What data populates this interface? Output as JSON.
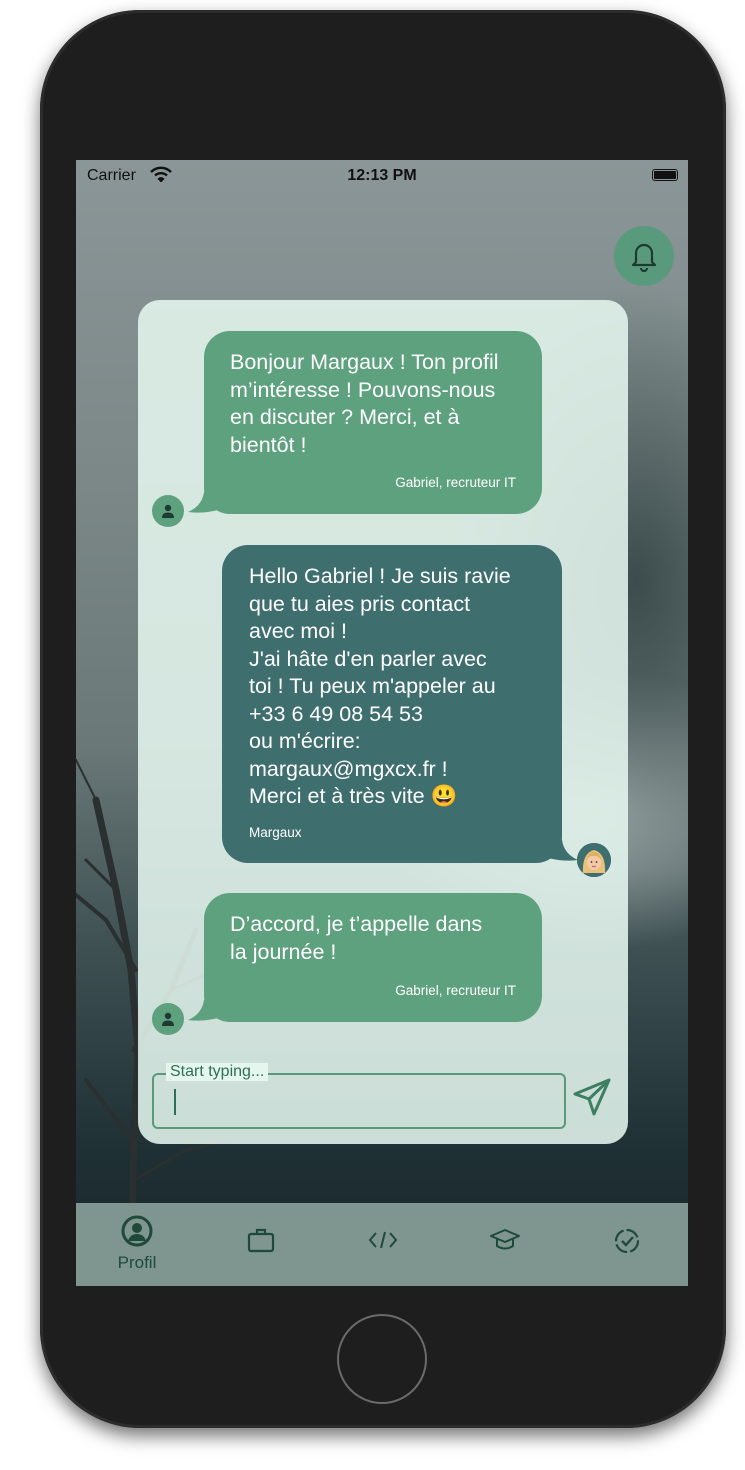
{
  "status_bar": {
    "carrier": "Carrier",
    "time": "12:13 PM"
  },
  "notification": {
    "icon": "bell-icon"
  },
  "messages": [
    {
      "from": "recruiter",
      "text": "Bonjour Margaux ! Ton profil\nm’intéresse ! Pouvons-nous\nen discuter ? Merci, et à\nbientôt !",
      "signature": "Gabriel, recruteur IT"
    },
    {
      "from": "self",
      "text": "Hello Gabriel ! Je suis ravie\nque tu aies pris contact\navec moi !\nJ'ai hâte d'en parler avec\ntoi ! Tu peux m'appeler au\n+33 6 49 08 54 53\nou m'écrire:\nmargaux@mgxcx.fr !\nMerci et à très vite 😃",
      "signature": "Margaux"
    },
    {
      "from": "recruiter",
      "text": "D’accord, je t’appelle dans\nla journée !",
      "signature": "Gabriel, recruteur IT"
    }
  ],
  "composer": {
    "label": "Start typing...",
    "value": "",
    "send_icon": "send-icon"
  },
  "tabs": [
    {
      "label": "Profil",
      "icon": "user-circle-icon",
      "active": true
    },
    {
      "label": "",
      "icon": "briefcase-icon",
      "active": false
    },
    {
      "label": "",
      "icon": "code-icon",
      "active": false
    },
    {
      "label": "",
      "icon": "graduation-cap-icon",
      "active": false
    },
    {
      "label": "",
      "icon": "badge-check-icon",
      "active": false
    }
  ],
  "colors": {
    "bubble_recruiter": "#5ea17f",
    "bubble_self": "#3f6e6e",
    "accent": "#5a9a7c",
    "tab_bar": "#7f9690"
  }
}
